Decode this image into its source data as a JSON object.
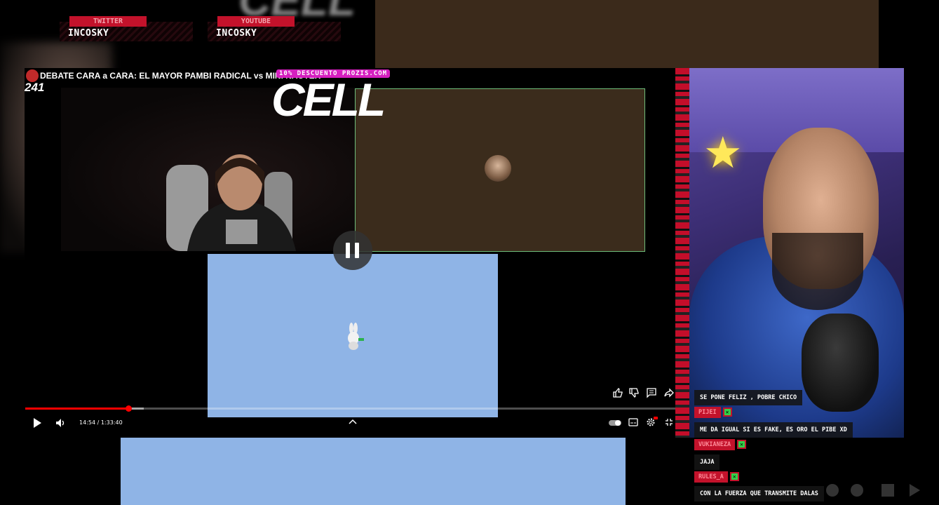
{
  "overlay": {
    "twitter": {
      "tag": "TWITTER",
      "name": "INCOSKY"
    },
    "youtube": {
      "tag": "YOUTUBE",
      "name": "INCOSKY"
    },
    "big_brand_blurred": "CELL"
  },
  "video": {
    "title": "DEBATE CARA a CARA: EL MAYOR PAMBI RADICAL vs MINI NAUTER",
    "counter_badge": "241",
    "promo": "10% DESCUENTO PROZIS.COM",
    "brand_logo": "CELL",
    "time": "14:54 / 1:33:40",
    "progress": 0.159,
    "colors": {
      "accent": "#ff0000",
      "panel_brown": "#3b2c1c",
      "panel_blue": "#8fb4e6",
      "panel_border": "#6dbd7a"
    },
    "actions": [
      "like-icon",
      "dislike-icon",
      "comments-icon",
      "share-icon"
    ],
    "controls_right": [
      "autoplay-toggle",
      "subtitles-icon",
      "settings-icon",
      "exit-fullscreen-icon"
    ]
  },
  "chat": {
    "messages": [
      {
        "type": "text",
        "text": "SE PONE FELIZ , POBRE CHICO"
      },
      {
        "type": "user",
        "user": "PIJEI"
      },
      {
        "type": "text",
        "text": "ME DA IGUAL SI ES FAKE, ES ORO EL PIBE XD"
      },
      {
        "type": "user",
        "user": "VUKIANEZA"
      },
      {
        "type": "text",
        "text": "JAJA"
      },
      {
        "type": "user",
        "user": "RULES_A"
      },
      {
        "type": "text",
        "text": "CON LA FUERZA QUE TRANSMITE DALAS"
      }
    ],
    "badge_icon": "check-badge-icon"
  }
}
